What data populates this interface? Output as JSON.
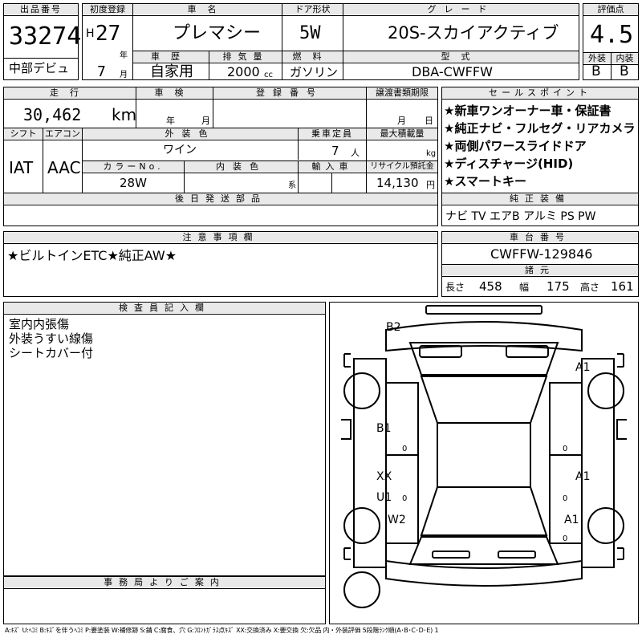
{
  "header": {
    "lot_label": "出品番号",
    "lot_number": "33274",
    "debut_label": "中部デビュ",
    "first_reg_label": "初度登録",
    "era": "H",
    "year": "27",
    "year_unit": "年",
    "month": "7",
    "month_unit": "月",
    "car_name_label": "車名",
    "car_name": "プレマシー",
    "door_label": "ドア形状",
    "door": "5W",
    "grade_label": "グレード",
    "grade": "20S-スカイアクティブ",
    "score_label": "評価点",
    "score": "4.5",
    "history_label": "車歴",
    "history": "自家用",
    "displacement_label": "排気量",
    "displacement": "2000",
    "displacement_unit": "cc",
    "fuel_label": "燃料",
    "fuel": "ガソリン",
    "model_label": "型式",
    "model": "DBA-CWFFW",
    "exterior_label": "外装",
    "interior_label": "内装",
    "exterior_grade": "B",
    "interior_grade": "B"
  },
  "row2": {
    "mileage_label": "走行",
    "mileage": "30,462",
    "mileage_unit": "km",
    "inspection_label": "車検",
    "inspection_year_unit": "年",
    "inspection_month_unit": "月",
    "registration_label": "登録番号",
    "transfer_label": "譲渡書類期限",
    "transfer_month_unit": "月",
    "transfer_day_unit": "日",
    "shift_label": "シフト",
    "shift": "IAT",
    "ac_label": "エアコン",
    "ac": "AAC",
    "color_label": "外装色",
    "color": "ワイン",
    "capacity_label": "乗車定員",
    "capacity": "7",
    "capacity_unit": "人",
    "load_label": "最大積載量",
    "load_unit": "kg",
    "color_no_label": "カラーNo.",
    "color_no": "28W",
    "interior_color_label": "内装色",
    "interior_color_unit": "系",
    "import_label": "輸入車",
    "recycle_label": "リサイクル預託金",
    "recycle": "14,130",
    "recycle_unit": "円",
    "later_parts_label": "後日発送部品"
  },
  "sales_points": {
    "label": "セールスポイント",
    "items": [
      "★新車ワンオーナー車・保証書",
      "★純正ナビ・フルセグ・リアカメラ",
      "★両側パワースライドドア",
      "★ディスチャージ(HID)",
      "★スマートキー"
    ]
  },
  "equipment": {
    "label": "純正装備",
    "value": "ナビ TV エアB アルミ PS PW"
  },
  "notes": {
    "label": "注意事項欄",
    "value": "★ビルトインETC★純正AW★"
  },
  "chassis": {
    "label": "車台番号",
    "value": "CWFFW-129846",
    "dims_label": "諸元",
    "length_label": "長さ",
    "length": "458",
    "width_label": "幅",
    "width": "175",
    "height_label": "高さ",
    "height": "161"
  },
  "inspector": {
    "label": "検査員記入欄",
    "lines": [
      "室内内張傷",
      "外装うすい線傷",
      "シートカバー付"
    ]
  },
  "office": {
    "label": "事務局よりご案内"
  },
  "diagram": {
    "marks": [
      "B2",
      "A1",
      "B1",
      "XX",
      "U1",
      "A1",
      "W2",
      "A1"
    ],
    "zeros": [
      "0",
      "0",
      "0",
      "0",
      "0"
    ]
  },
  "legend": "A:ｷｽﾞ U:ﾍｺﾐ B:ｷｽﾞを伴うﾍｺﾐ P:要塗装 W:補修跡 S:錆 C:腐食、穴 G:ﾌﾛﾝﾄｶﾞﾗｽ点ｷｽﾞ XX:交換済み X:要交換 欠:欠品 内・外装評価 5段階ﾗﾝｸ順(A･B･C･D･E) 1"
}
